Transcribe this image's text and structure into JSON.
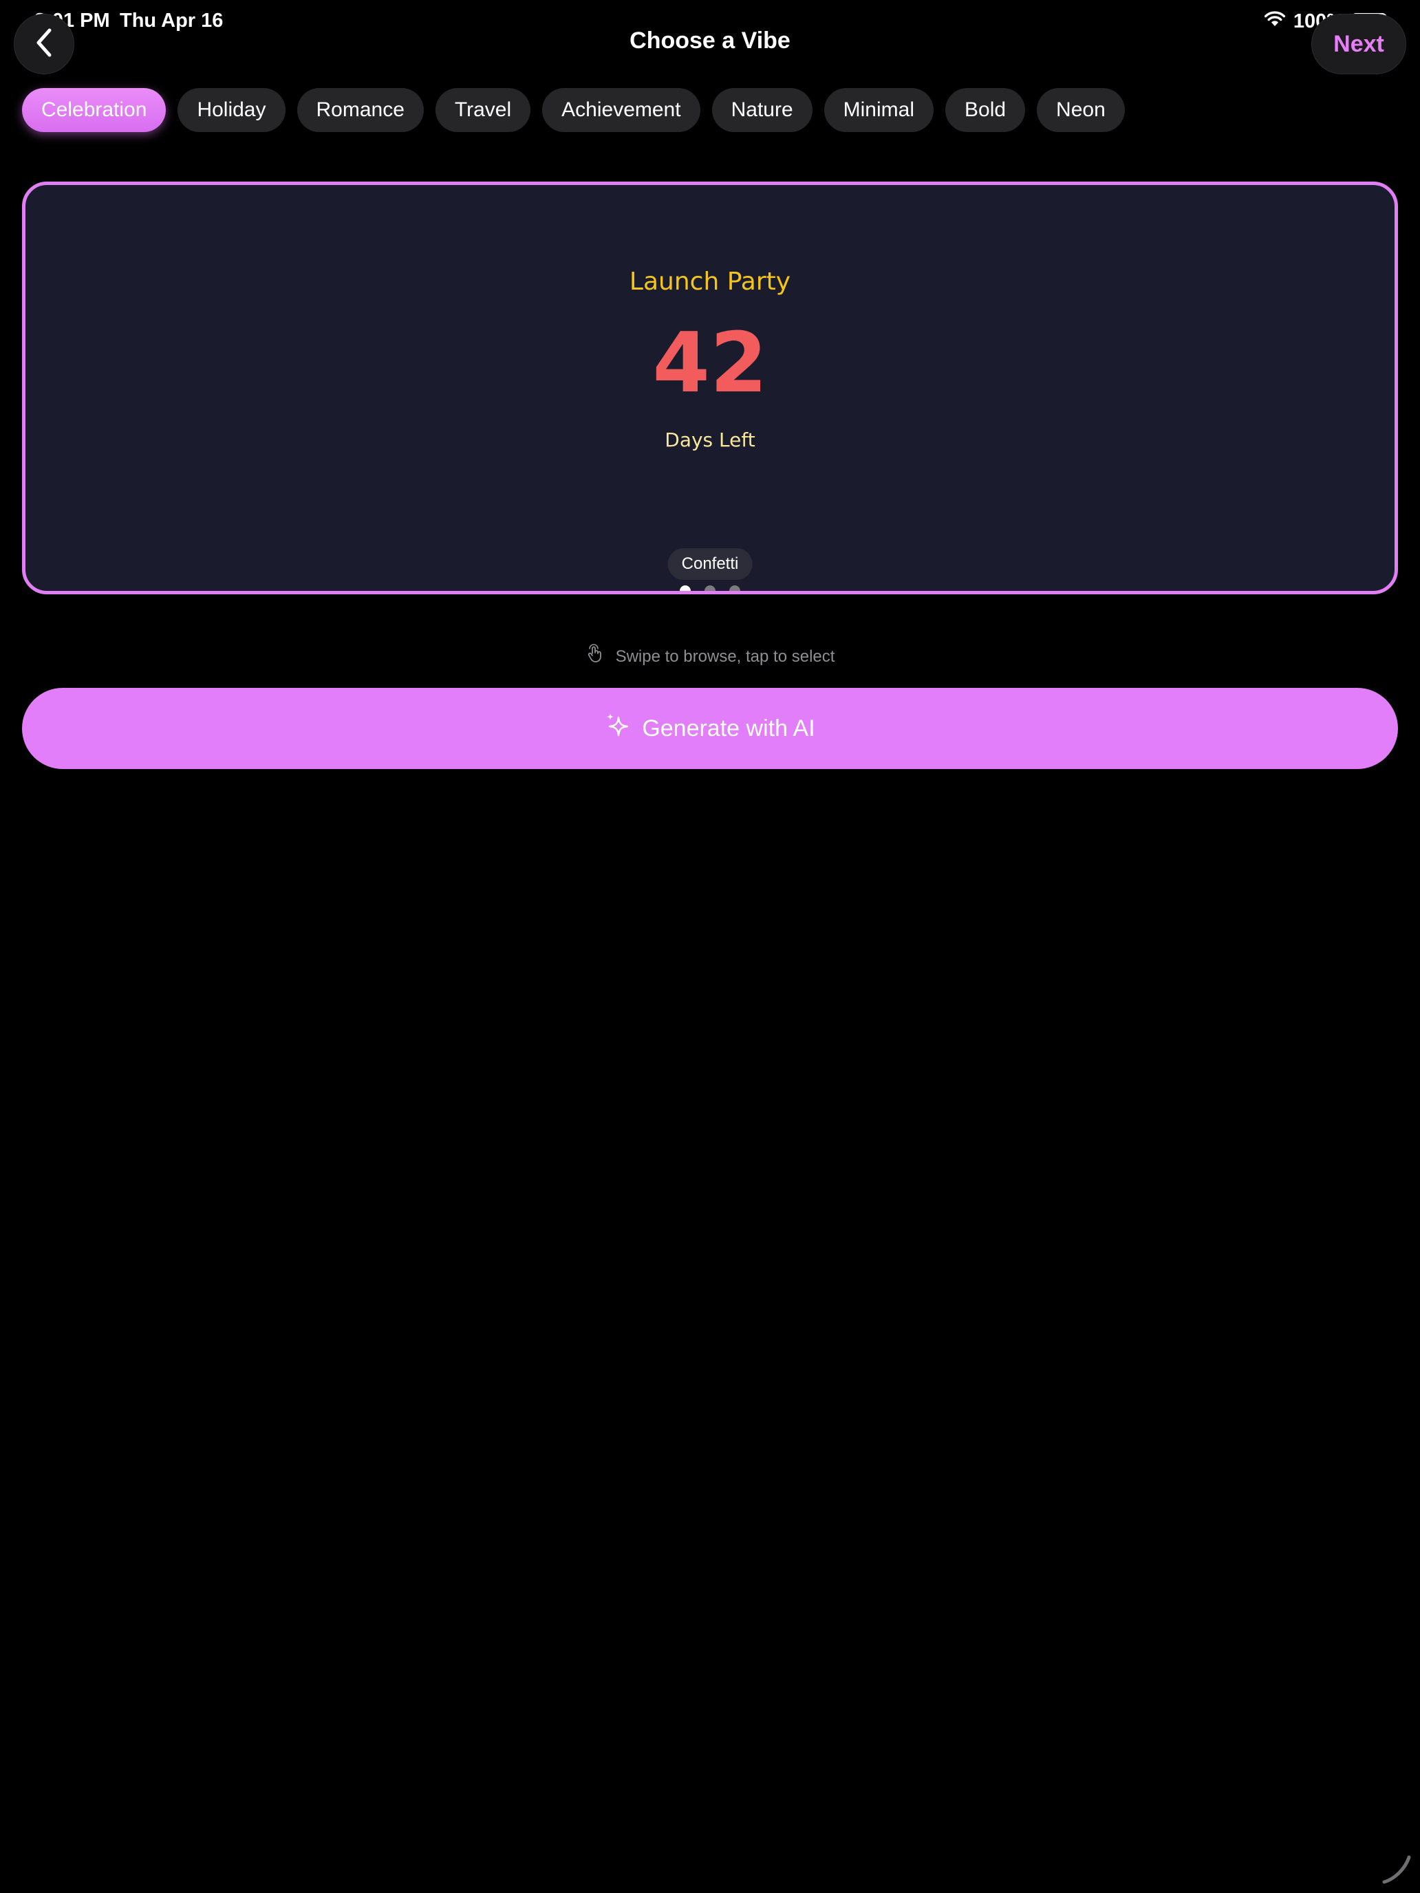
{
  "status_bar": {
    "time": "8:01 PM",
    "date": "Thu Apr 16",
    "battery": "100%"
  },
  "header": {
    "title": "Choose a Vibe",
    "next_label": "Next"
  },
  "categories": [
    {
      "label": "Celebration",
      "selected": true
    },
    {
      "label": "Holiday",
      "selected": false
    },
    {
      "label": "Romance",
      "selected": false
    },
    {
      "label": "Travel",
      "selected": false
    },
    {
      "label": "Achievement",
      "selected": false
    },
    {
      "label": "Nature",
      "selected": false
    },
    {
      "label": "Minimal",
      "selected": false
    },
    {
      "label": "Bold",
      "selected": false
    },
    {
      "label": "Neon",
      "selected": false
    }
  ],
  "preview": {
    "title": "Launch Party",
    "number": "42",
    "caption": "Days Left",
    "style_name": "Confetti",
    "page_count": 3,
    "current_page": 1
  },
  "hint": {
    "text": "Swipe to browse, tap to select",
    "icon": "hand-tap-icon"
  },
  "generate": {
    "label": "Generate with AI",
    "icon": "sparkles-icon"
  },
  "colors": {
    "accent": "#e27ef9",
    "card_background": "#1a1c2e",
    "title_yellow": "#f5c518",
    "number_red": "#f25c5c",
    "caption_yellow": "#f8e79a"
  }
}
